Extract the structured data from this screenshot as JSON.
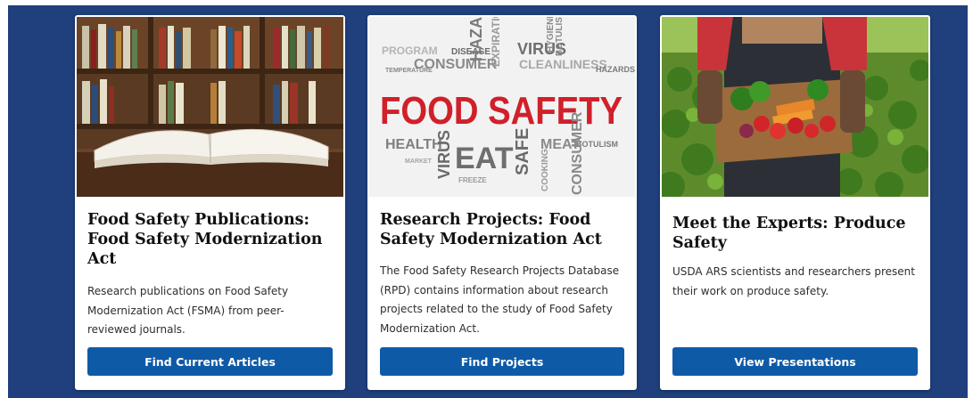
{
  "cards": [
    {
      "title": "Food Safety Publications: Food Safety Modernization Act",
      "description": "Research publications on Food Safety Modernization Act (FSMA) from peer-reviewed journals.",
      "button_label": "Find Current Articles",
      "image_icon": "open-book-library-image"
    },
    {
      "title": "Research Projects: Food Safety Modernization Act",
      "description": "The Food Safety Research Projects Database (RPD) contains information about research projects related to the study of Food Safety Modernization Act.",
      "button_label": "Find Projects",
      "image_icon": "food-safety-word-cloud-image",
      "image_words": {
        "main": "FOOD SAFETY",
        "eat": "EAT",
        "safe": "SAFE",
        "virus": "VIRUS",
        "health": "HEALTH",
        "meat": "MEAT",
        "consumer": "CONSUMER",
        "hazards": "HAZARDS",
        "cleanliness": "CLEANLINESS",
        "expiration": "EXPIRATION",
        "botulism": "BOTULISM",
        "freeze": "FREEZE",
        "cooking": "COOKING",
        "program": "PROGRAM",
        "disease": "DISEASE",
        "hygiene": "HYGIENE",
        "temperature": "TEMPERATURE",
        "market": "MARKET"
      }
    },
    {
      "title": "Meet the Experts: Produce Safety",
      "description": "USDA ARS scientists and researchers present their work on produce safety.",
      "button_label": "View Presentations",
      "image_icon": "farmer-produce-crate-image"
    }
  ],
  "colors": {
    "background_band": "#1f3f7d",
    "button": "#0e5aa7",
    "food_safety_red": "#d0202a"
  }
}
